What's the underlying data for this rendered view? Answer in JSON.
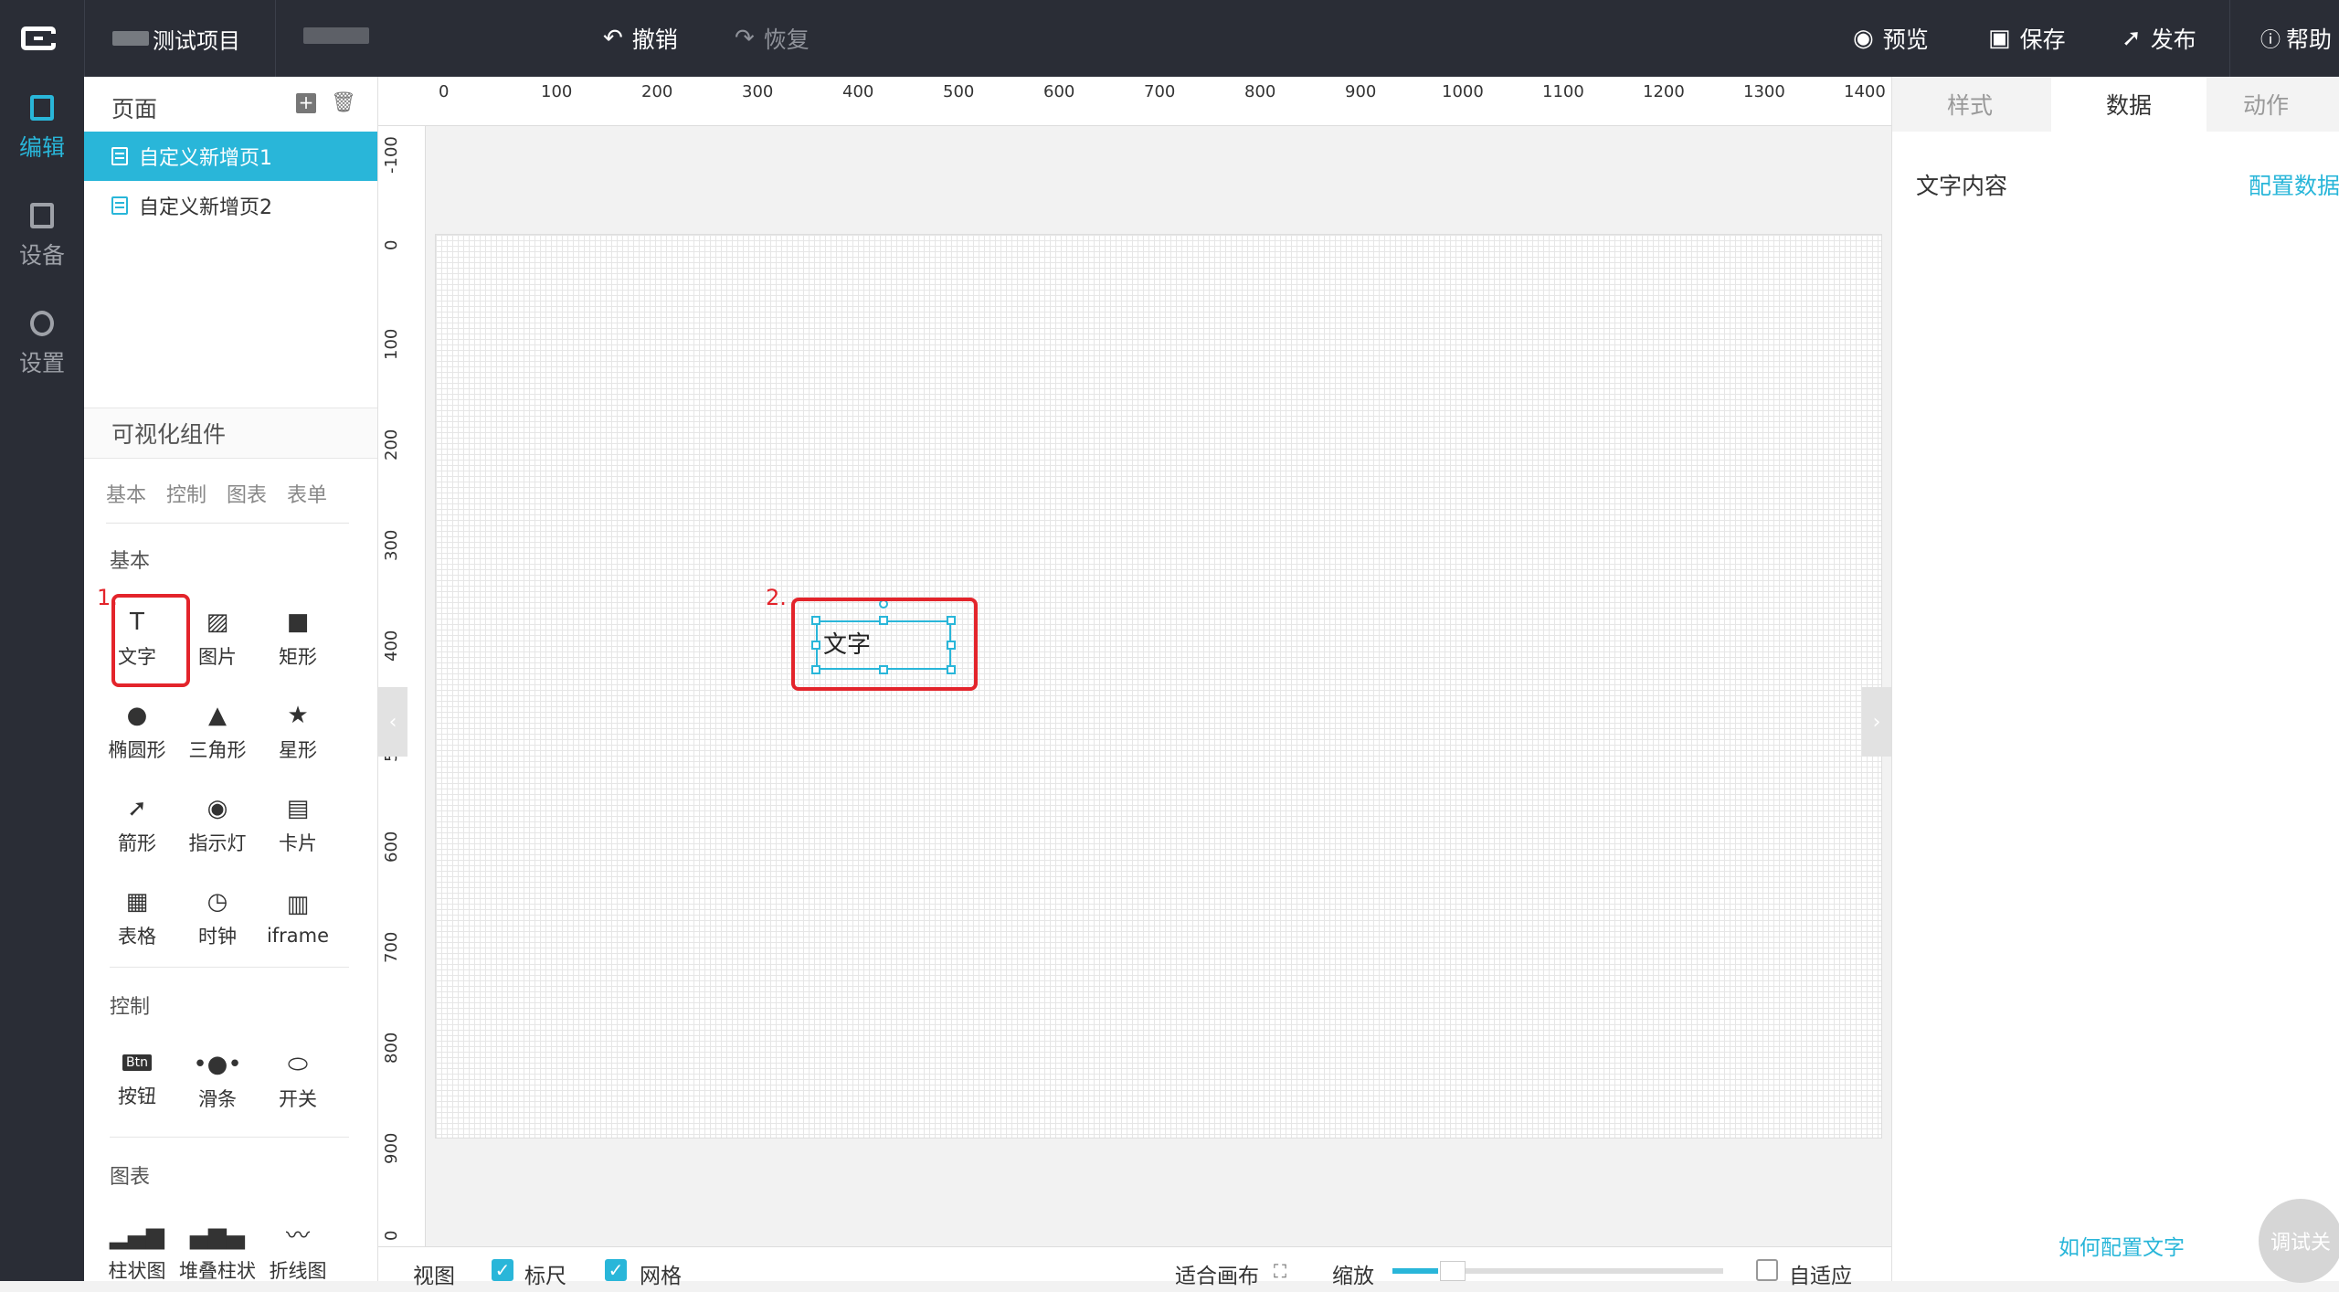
{
  "topbar": {
    "project_name": "测试项目",
    "undo_label": "撤销",
    "redo_label": "恢复",
    "preview_label": "预览",
    "save_label": "保存",
    "publish_label": "发布",
    "help_label": "帮助"
  },
  "leftnav": {
    "items": [
      {
        "label": "编辑"
      },
      {
        "label": "设备"
      },
      {
        "label": "设置"
      }
    ]
  },
  "pages": {
    "title": "页面",
    "items": [
      {
        "label": "自定义新增页1"
      },
      {
        "label": "自定义新增页2"
      }
    ]
  },
  "components": {
    "title": "可视化组件",
    "tabs": [
      "基本",
      "控制",
      "图表",
      "表单"
    ],
    "basic_title": "基本",
    "basic": [
      {
        "label": "文字",
        "icon": "text-icon"
      },
      {
        "label": "图片",
        "icon": "image-icon"
      },
      {
        "label": "矩形",
        "icon": "rectangle-icon"
      },
      {
        "label": "椭圆形",
        "icon": "ellipse-icon"
      },
      {
        "label": "三角形",
        "icon": "triangle-icon"
      },
      {
        "label": "星形",
        "icon": "star-icon"
      },
      {
        "label": "箭形",
        "icon": "arrow-icon"
      },
      {
        "label": "指示灯",
        "icon": "indicator-icon"
      },
      {
        "label": "卡片",
        "icon": "card-icon"
      },
      {
        "label": "表格",
        "icon": "table-icon"
      },
      {
        "label": "时钟",
        "icon": "clock-icon"
      },
      {
        "label": "iframe",
        "icon": "iframe-icon"
      }
    ],
    "control_title": "控制",
    "control": [
      {
        "label": "按钮",
        "icon": "button-icon"
      },
      {
        "label": "滑条",
        "icon": "slider-icon"
      },
      {
        "label": "开关",
        "icon": "switch-icon"
      }
    ],
    "chart_title": "图表",
    "chart": [
      {
        "label": "柱状图",
        "icon": "bar-chart-icon"
      },
      {
        "label": "堆叠柱状",
        "icon": "stacked-bar-icon"
      },
      {
        "label": "折线图",
        "icon": "line-chart-icon"
      }
    ]
  },
  "annotations": {
    "step1": "1.",
    "step2": "2."
  },
  "ruler": {
    "top": [
      "0",
      "100",
      "200",
      "300",
      "400",
      "500",
      "600",
      "700",
      "800",
      "900",
      "1000",
      "1100",
      "1200",
      "1300",
      "1400"
    ],
    "left": [
      "-100",
      "0",
      "100",
      "200",
      "300",
      "400",
      "5",
      "600",
      "700",
      "800",
      "900",
      "0"
    ]
  },
  "canvas": {
    "text_widget": "文字"
  },
  "bottombar": {
    "view_label": "视图",
    "ruler_label": "标尺",
    "grid_label": "网格",
    "fit_label": "适合画布",
    "zoom_label": "缩放",
    "auto_label": "自适应"
  },
  "rightpanel": {
    "tabs": [
      "样式",
      "数据",
      "动作"
    ],
    "field_label": "文字内容",
    "config_link": "配置数据",
    "help_link": "如何配置文字",
    "debug_label": "调试关"
  },
  "colors": {
    "accent": "#29b6d9",
    "topbar": "#2a2d36",
    "annotation": "#e3242b"
  }
}
